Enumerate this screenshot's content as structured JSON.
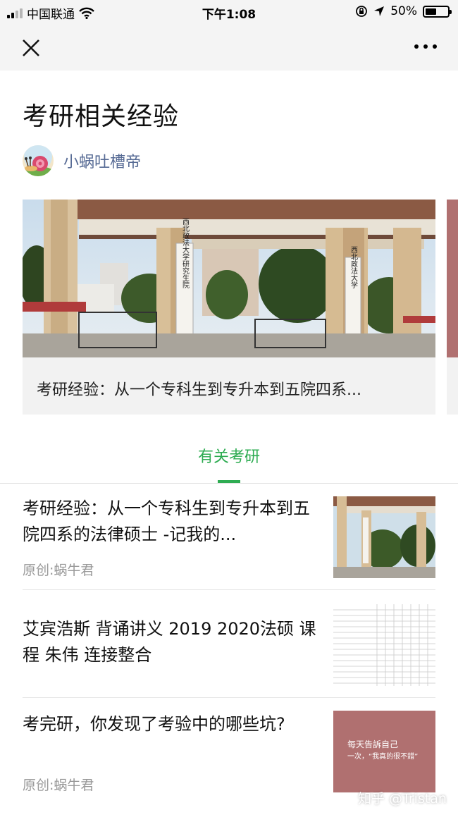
{
  "status_bar": {
    "carrier": "中国联通",
    "time": "下午1:08",
    "battery_percent_label": "50%",
    "battery_level": 0.5
  },
  "nav": {
    "close_icon": "close-icon",
    "more_icon": "more-icon"
  },
  "page": {
    "title": "考研相关经验"
  },
  "author": {
    "name": "小蜗吐槽帝"
  },
  "featured": {
    "caption": "考研经验：从一个专科生到专升本到五院四系...",
    "image_text_left": "西北政法大学研究生院",
    "image_text_right": "西北政法大学"
  },
  "section": {
    "tab_label": "有关考研"
  },
  "articles": [
    {
      "title": "考研经验：从一个专科生到专升本到五院四系的法律硕士 -记我的...",
      "source": "原创:蜗牛君"
    },
    {
      "title": "艾宾浩斯 背诵讲义 2019 2020法硕 课程 朱伟 连接整合",
      "source": ""
    },
    {
      "title": "考完研，你发现了考验中的哪些坑?",
      "source": "原创:蜗牛君",
      "thumb_text_line1": "每天告訴自己",
      "thumb_text_line2": "一次，“我真的很不錯”"
    }
  ],
  "watermark": "知乎 @Tristan",
  "colors": {
    "accent_green": "#2eac52",
    "link_blue": "#576b95",
    "thumb_pink": "#b07070"
  }
}
